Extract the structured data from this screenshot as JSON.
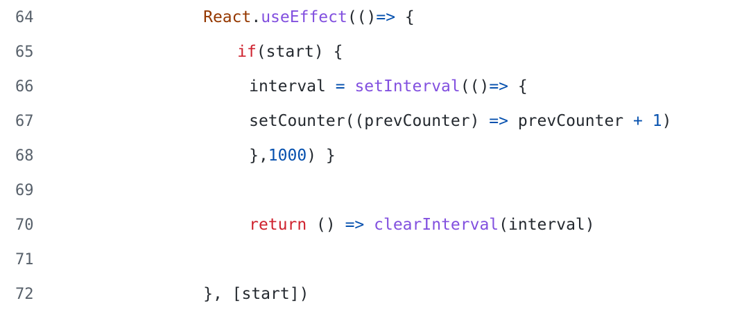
{
  "code_view": {
    "language": "javascript",
    "colors": {
      "plain": "#24292f",
      "line_number": "#57606a",
      "class_name": "#953800",
      "function": "#8250df",
      "keyword": "#cf222e",
      "operator": "#0550ae",
      "number": "#0550ae",
      "background": "#ffffff"
    },
    "lines": [
      {
        "number": "64",
        "tokens": [
          {
            "text": "React",
            "kind": "class"
          },
          {
            "text": ".",
            "kind": "plain"
          },
          {
            "text": "useEffect",
            "kind": "func"
          },
          {
            "text": "(()",
            "kind": "plain"
          },
          {
            "text": "=>",
            "kind": "op"
          },
          {
            "text": " {",
            "kind": "plain"
          }
        ]
      },
      {
        "number": "65",
        "tokens": [
          {
            "text": "if",
            "kind": "kw"
          },
          {
            "text": "(start) {",
            "kind": "plain"
          }
        ]
      },
      {
        "number": "66",
        "tokens": [
          {
            "text": "interval ",
            "kind": "plain"
          },
          {
            "text": "=",
            "kind": "op"
          },
          {
            "text": " ",
            "kind": "plain"
          },
          {
            "text": "setInterval",
            "kind": "func"
          },
          {
            "text": "(()",
            "kind": "plain"
          },
          {
            "text": "=>",
            "kind": "op"
          },
          {
            "text": " {",
            "kind": "plain"
          }
        ]
      },
      {
        "number": "67",
        "tokens": [
          {
            "text": "setCounter((prevCounter) ",
            "kind": "plain"
          },
          {
            "text": "=>",
            "kind": "op"
          },
          {
            "text": " prevCounter ",
            "kind": "plain"
          },
          {
            "text": "+",
            "kind": "op"
          },
          {
            "text": " ",
            "kind": "plain"
          },
          {
            "text": "1",
            "kind": "num"
          },
          {
            "text": ")",
            "kind": "plain"
          }
        ]
      },
      {
        "number": "68",
        "tokens": [
          {
            "text": "},",
            "kind": "plain"
          },
          {
            "text": "1000",
            "kind": "num"
          },
          {
            "text": ") }",
            "kind": "plain"
          }
        ]
      },
      {
        "number": "69",
        "tokens": []
      },
      {
        "number": "70",
        "tokens": [
          {
            "text": "return",
            "kind": "kw"
          },
          {
            "text": " () ",
            "kind": "plain"
          },
          {
            "text": "=>",
            "kind": "op"
          },
          {
            "text": " ",
            "kind": "plain"
          },
          {
            "text": "clearInterval",
            "kind": "func"
          },
          {
            "text": "(interval)",
            "kind": "plain"
          }
        ]
      },
      {
        "number": "71",
        "tokens": []
      },
      {
        "number": "72",
        "tokens": [
          {
            "text": "}, [start])",
            "kind": "plain"
          }
        ]
      }
    ]
  }
}
